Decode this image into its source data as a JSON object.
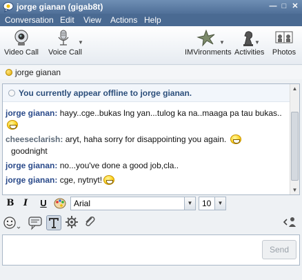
{
  "window": {
    "title": "jorge gianan (gigab8t)"
  },
  "menu": [
    "Conversation",
    "Edit",
    "View",
    "Actions",
    "Help"
  ],
  "toolbar": {
    "video_call": "Video Call",
    "voice_call": "Voice Call",
    "imvironments": "IMVironments",
    "activities": "Activities",
    "photos": "Photos"
  },
  "contact": {
    "name": "jorge gianan",
    "status_color": "#f0c000"
  },
  "notice": "You currently appear offline to jorge gianan.",
  "messages": [
    {
      "sender": "jorge gianan:",
      "text": "hayy..cge..bukas lng yan...tulog ka na..maaga pa tau bukas..",
      "emoticon": "big-grin"
    },
    {
      "sender": "cheeseclarish:",
      "text": "aryt, haha sorry for disappointing you again.",
      "emoticon": "big-grin",
      "text2": "goodnight"
    },
    {
      "sender": "jorge gianan:",
      "text": "no...you've done a good job,cla.."
    },
    {
      "sender": "jorge gianan:",
      "text": "cge, nytnyt!",
      "emoticon": "big-grin"
    }
  ],
  "format": {
    "bold": "B",
    "italic": "I",
    "underline": "U",
    "font": "Arial",
    "size": "10"
  },
  "send_label": "Send",
  "colors": {
    "titlebar": "#5f7fa8",
    "menubar": "#4a6a92",
    "sender": "#2a4a8a",
    "notice_text": "#2b4e7b"
  }
}
